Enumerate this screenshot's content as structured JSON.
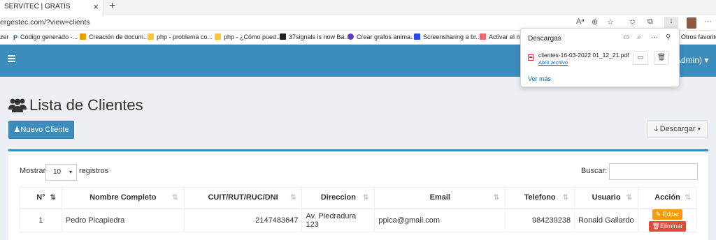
{
  "browser": {
    "tab_title": "SERVITEC | GRATIS",
    "url": "ergestec.com/?view=clients",
    "bookmarks": [
      {
        "label": "zer",
        "icon": "",
        "color": "#ffffff"
      },
      {
        "label": "Código generado -...",
        "icon": "P",
        "color": "#1a4fa0"
      },
      {
        "label": "Creación de docum...",
        "icon": "c",
        "color": "#e8a000"
      },
      {
        "label": "php - problema co...",
        "icon": "",
        "color": "#f4c542"
      },
      {
        "label": "php - ¿Cómo pued...",
        "icon": "",
        "color": "#f4c542"
      },
      {
        "label": "37signals is now Ba...",
        "icon": "",
        "color": "#222222"
      },
      {
        "label": "Crear grafos anima...",
        "icon": "",
        "color": "#5b3fbf"
      },
      {
        "label": "Screensharing a br...",
        "icon": "",
        "color": "#264de4"
      },
      {
        "label": "Activar el mó",
        "icon": "",
        "color": "#e86a6a"
      },
      {
        "label": "Otros favoritos",
        "icon": "",
        "color": "#f1c232"
      }
    ]
  },
  "downloads": {
    "title": "Descargas",
    "file_name": "clientes-16-03-2022 01_12_21.pdf",
    "open_label": "Abrir archivo",
    "more_label": "Ver más"
  },
  "header": {
    "user_label": "Admin) ▾"
  },
  "page": {
    "title": "Lista de Clientes",
    "new_button": "Nuevo Cliente",
    "download_button": "Descargar ▾"
  },
  "table": {
    "show_label": "Mostrar",
    "show_value": "10",
    "show_after": "registros",
    "search_label": "Buscar:",
    "columns": [
      "N°",
      "Nombre Completo",
      "CUIT/RUT/RUC/DNI",
      "Direccion",
      "Email",
      "Telefono",
      "Usuario",
      "Acción"
    ],
    "rows": [
      {
        "n": "1",
        "nombre": "Pedro Picapiedra",
        "doc": "2147483647",
        "direccion": "Av. Piedradura 123",
        "email": "ppica@gmail.com",
        "telefono": "984239238",
        "usuario": "Ronald Gallardo",
        "edit_label": "Editar",
        "delete_label": "Eliminar"
      }
    ]
  },
  "colors": {
    "primary": "#3c8dbc",
    "warning": "#f39c12",
    "danger": "#dd4b39",
    "background": "#ecf0f5"
  }
}
